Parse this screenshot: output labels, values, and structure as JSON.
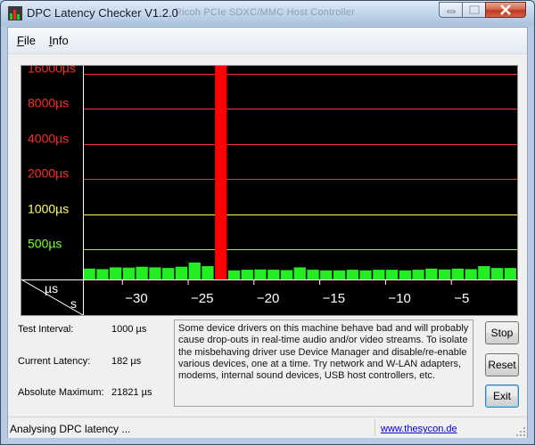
{
  "window": {
    "title": "DPC Latency Checker V1.2.0",
    "background_title": "Ricoh PCIe SDXC/MMC Host Controller"
  },
  "menu": {
    "file": "File",
    "info": "Info"
  },
  "chart_data": {
    "type": "bar",
    "title": "",
    "y_axis_unit_label": "µs",
    "x_axis_unit_label": "s",
    "y_ticks": [
      {
        "value": 500,
        "label": "500µs",
        "color": "#7cff2a"
      },
      {
        "value": 1000,
        "label": "1000µs",
        "color": "#ffff60"
      },
      {
        "value": 2000,
        "label": "2000µs",
        "color": "#ff2a2a"
      },
      {
        "value": 4000,
        "label": "4000µs",
        "color": "#ff2a2a"
      },
      {
        "value": 8000,
        "label": "8000µs",
        "color": "#ff2a2a"
      },
      {
        "value": 16000,
        "label": "16000µs",
        "color": "#ff2a2a"
      }
    ],
    "x_ticks": [
      {
        "value": -30,
        "label": "−30"
      },
      {
        "value": -25,
        "label": "−25"
      },
      {
        "value": -20,
        "label": "−20"
      },
      {
        "value": -15,
        "label": "−15"
      },
      {
        "value": -10,
        "label": "−10"
      },
      {
        "value": -5,
        "label": "−5"
      }
    ],
    "xlim": [
      -33,
      0
    ],
    "ylim": [
      0,
      21821
    ],
    "grid": true,
    "x": [
      -33,
      -32,
      -31,
      -30,
      -29,
      -28,
      -27,
      -26,
      -25,
      -24,
      -23,
      -22,
      -21,
      -20,
      -19,
      -18,
      -17,
      -16,
      -15,
      -14,
      -13,
      -12,
      -11,
      -10,
      -9,
      -8,
      -7,
      -6,
      -5,
      -4,
      -3,
      -2,
      -1
    ],
    "values": [
      180,
      170,
      200,
      195,
      210,
      200,
      190,
      210,
      280,
      220,
      21821,
      150,
      160,
      165,
      160,
      155,
      200,
      160,
      150,
      150,
      160,
      150,
      160,
      160,
      150,
      160,
      180,
      165,
      180,
      170,
      220,
      190,
      190
    ],
    "bar_colors": {
      "normal": "#22ee22",
      "alert": "#ff0000"
    }
  },
  "info": {
    "test_interval_label": "Test Interval:",
    "test_interval_value": "1000 µs",
    "current_latency_label": "Current Latency:",
    "current_latency_value": "182 µs",
    "absolute_maximum_label": "Absolute Maximum:",
    "absolute_maximum_value": "21821 µs"
  },
  "message": "Some device drivers on this machine behave bad and will probably cause drop-outs in real-time audio and/or video streams. To isolate the misbehaving driver use Device Manager and disable/re-enable various devices, one at a time. Try network and W-LAN adapters, modems, internal sound devices, USB host controllers, etc.",
  "buttons": {
    "stop": "Stop",
    "reset": "Reset",
    "exit": "Exit"
  },
  "status": {
    "text": "Analysing DPC latency ...",
    "link": "www.thesycon.de"
  }
}
